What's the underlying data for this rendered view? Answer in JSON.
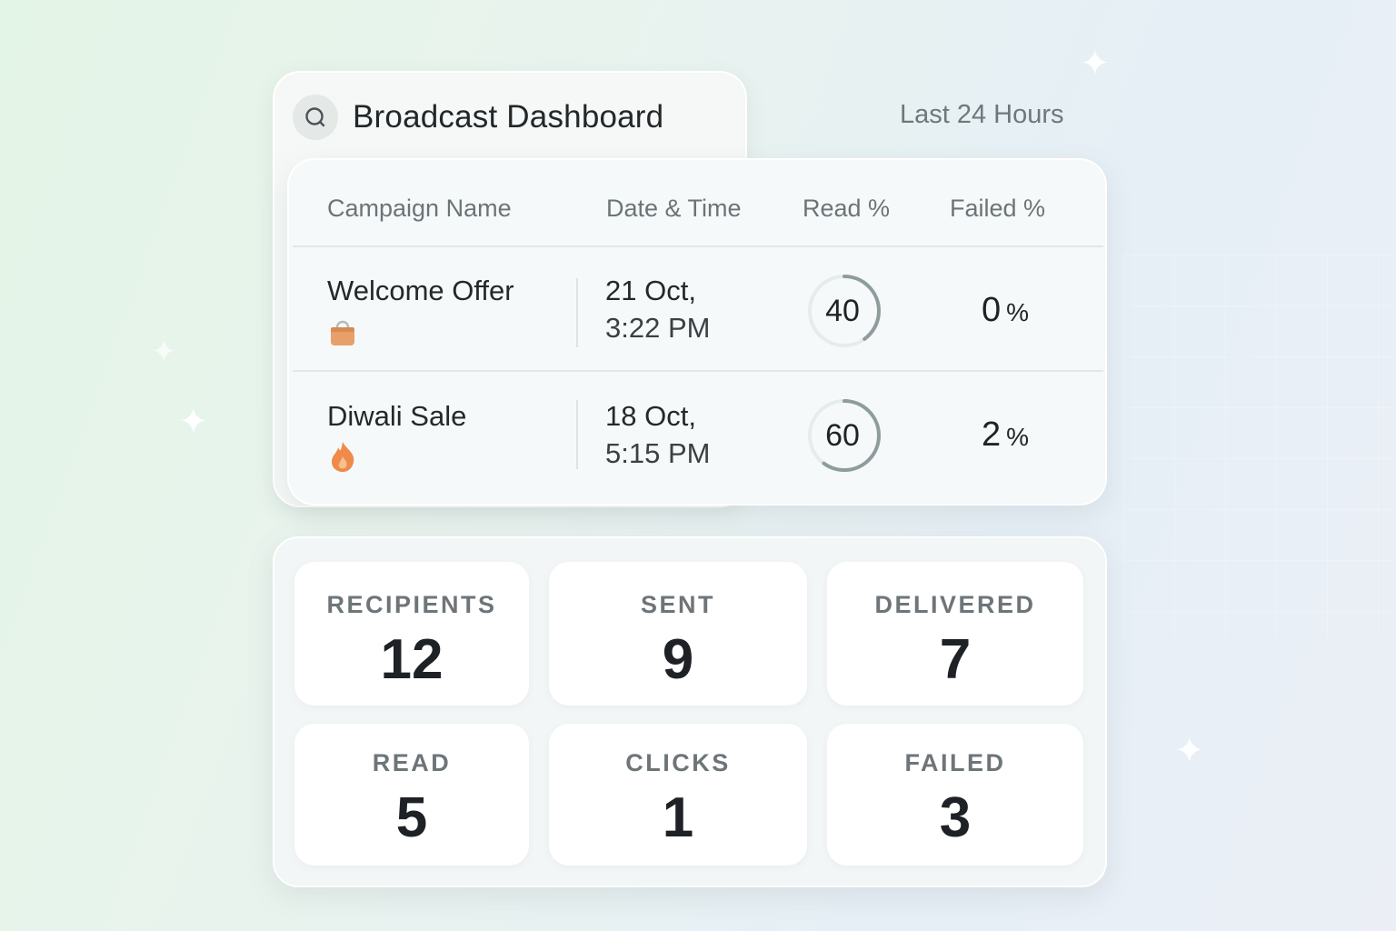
{
  "header": {
    "title": "Broadcast Dashboard",
    "period": "Last 24 Hours",
    "icon": "search-icon"
  },
  "table": {
    "columns": [
      "Campaign Name",
      "Date & Time",
      "Read %",
      "Failed %"
    ],
    "rows": [
      {
        "name": "Welcome Offer",
        "icon": "shopping-bag-icon",
        "date": "21 Oct,",
        "time": "3:22 PM",
        "read": "40",
        "read_fraction": 0.4,
        "failed": "0",
        "failed_unit": "%"
      },
      {
        "name": "Diwali Sale",
        "icon": "fire-icon",
        "date": "18 Oct,",
        "time": "5:15 PM",
        "read": "60",
        "read_fraction": 0.6,
        "failed": "2",
        "failed_unit": "%"
      }
    ]
  },
  "stats": [
    {
      "label": "RECIPIENTS",
      "value": "12"
    },
    {
      "label": "SENT",
      "value": "9"
    },
    {
      "label": "DELIVERED",
      "value": "7"
    },
    {
      "label": "READ",
      "value": "5"
    },
    {
      "label": "CLICKS",
      "value": "1"
    },
    {
      "label": "FAILED",
      "value": "3"
    }
  ],
  "colors": {
    "ring_progress": "#8e9c9e",
    "ring_track": "#e6ebeb",
    "bag": "#e8a06a",
    "fire": "#ef8a4a"
  }
}
